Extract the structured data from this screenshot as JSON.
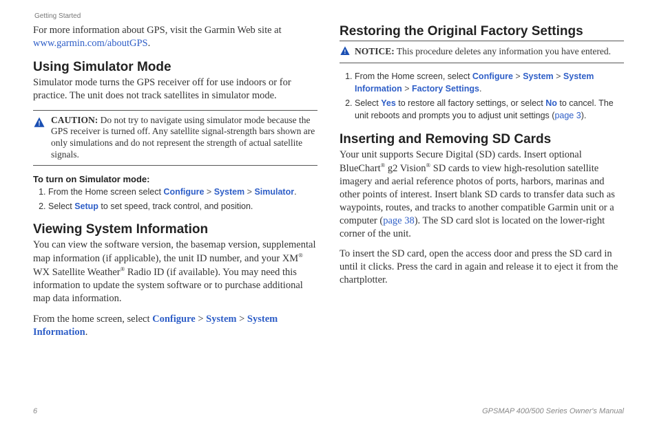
{
  "breadcrumb": "Getting Started",
  "left": {
    "intro": {
      "prefix": "For more information about GPS, visit the Garmin Web site at ",
      "link": "www.garmin.com/aboutGPS",
      "suffix": "."
    },
    "sim": {
      "heading": "Using Simulator Mode",
      "body": "Simulator mode turns the GPS receiver off for use indoors or for practice. The unit does not track satellites in simulator mode.",
      "caution_label": "CAUTION:",
      "caution_body": " Do not try to navigate using simulator mode because the GPS receiver is turned off. Any satellite signal-strength bars shown are only simulations and do not represent the strength of actual satellite signals.",
      "turn_on_heading": "To turn on Simulator mode:",
      "step1_prefix": "From the Home screen select ",
      "configure": "Configure",
      "system": "System",
      "simulator": "Simulator",
      "step2_prefix": "Select ",
      "setup": "Setup",
      "step2_suffix": " to set speed, track control, and position."
    },
    "sysinfo": {
      "heading": "Viewing System Information",
      "body": "You can view the software version, the basemap version, supplemental map information (if applicable), the unit ID number, and your XM® WX Satellite Weather® Radio ID (if available). You may need this information to update the system software or to purchase additional map data information.",
      "path_prefix": "From the home screen, select ",
      "configure": "Configure",
      "system": "System",
      "system_information": "System Information",
      "period": "."
    }
  },
  "right": {
    "restore": {
      "heading": "Restoring the Original Factory Settings",
      "notice_label": "NOTICE:",
      "notice_body": " This procedure deletes any information you have entered.",
      "step1_prefix": "From the Home screen, select ",
      "configure": "Configure",
      "system": "System",
      "system_information": "System Information",
      "factory_settings": "Factory Settings",
      "period": ".",
      "step2_prefix": "Select ",
      "yes": "Yes",
      "step2_mid": " to restore all factory settings, or select ",
      "no": "No",
      "step2_suffix": " to cancel. The unit reboots and prompts you to adjust unit settings (",
      "page_ref": "page 3",
      "step2_end": ")."
    },
    "sd": {
      "heading": "Inserting and Removing SD Cards",
      "body_prefix": "Your unit supports Secure Digital (SD) cards. Insert optional BlueChart® g2 Vision® SD cards to view high-resolution satellite imagery and aerial reference photos of ports, harbors, marinas and other points of interest. Insert blank SD cards to transfer data such as waypoints, routes, and tracks to another compatible Garmin unit or a computer (",
      "page_ref": "page 38",
      "body_suffix": "). The SD card slot is located on the lower-right corner of the unit.",
      "body2": "To insert the SD card, open the access door and press the SD card in until it clicks. Press the card in again and release it to eject it from the chartplotter."
    }
  },
  "footer": {
    "page": "6",
    "manual": "GPSMAP 400/500 Series Owner's Manual"
  },
  "sep": " > "
}
